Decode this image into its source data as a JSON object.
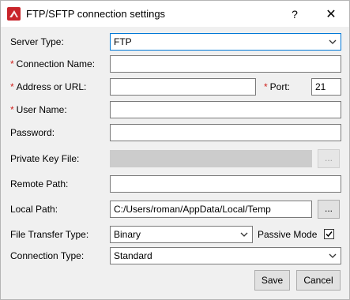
{
  "window": {
    "title": "FTP/SFTP connection settings",
    "help_label": "?",
    "close_label": "✕"
  },
  "form": {
    "server_type": {
      "label": "Server Type:",
      "value": "FTP"
    },
    "connection_name": {
      "required_mark": "*",
      "label": "Connection Name:",
      "value": ""
    },
    "address": {
      "required_mark": "*",
      "label": "Address or URL:",
      "value": ""
    },
    "port": {
      "required_mark": "*",
      "label": "Port:",
      "value": "21"
    },
    "user_name": {
      "required_mark": "*",
      "label": "User Name:",
      "value": ""
    },
    "password": {
      "label": "Password:",
      "value": ""
    },
    "private_key_file": {
      "label": "Private Key File:",
      "value": "",
      "browse_label": "..."
    },
    "remote_path": {
      "label": "Remote Path:",
      "value": ""
    },
    "local_path": {
      "label": "Local Path:",
      "value": "C:/Users/roman/AppData/Local/Temp",
      "browse_label": "..."
    },
    "file_transfer_type": {
      "label": "File Transfer Type:",
      "value": "Binary"
    },
    "passive_mode": {
      "label": "Passive Mode",
      "checked": true
    },
    "connection_type": {
      "label": "Connection Type:",
      "value": "Standard"
    }
  },
  "buttons": {
    "save": "Save",
    "cancel": "Cancel"
  },
  "colors": {
    "required": "#d0211c",
    "focus_border": "#0078d7",
    "app_icon": "#c8242a"
  },
  "icons": {
    "app": "app-logo-icon",
    "dropdown": "chevron-down-icon",
    "check": "checkmark-icon"
  }
}
